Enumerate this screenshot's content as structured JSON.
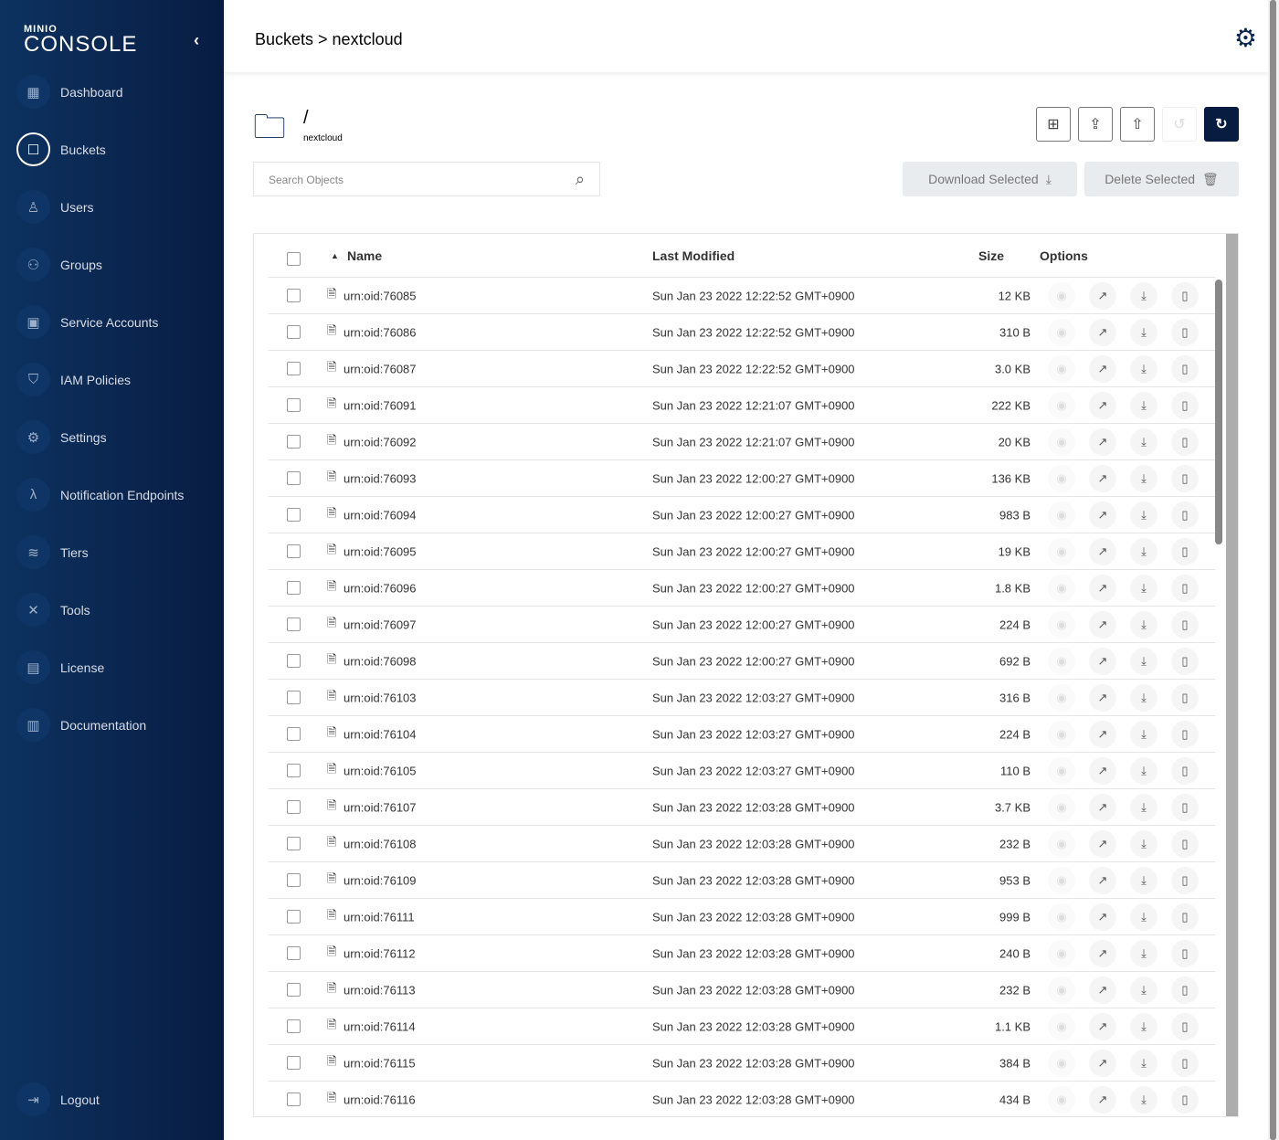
{
  "sidebar": {
    "logo_top": "MINIO",
    "logo_bottom": "CONSOLE",
    "items": [
      {
        "label": "Dashboard",
        "icon": "dashboard-icon",
        "glyph": "▦"
      },
      {
        "label": "Buckets",
        "icon": "bucket-icon",
        "glyph": "☐",
        "active": true
      },
      {
        "label": "Users",
        "icon": "user-icon",
        "glyph": "♙"
      },
      {
        "label": "Groups",
        "icon": "groups-icon",
        "glyph": "⚇"
      },
      {
        "label": "Service Accounts",
        "icon": "service-accounts-icon",
        "glyph": "▣"
      },
      {
        "label": "IAM Policies",
        "icon": "shield-icon",
        "glyph": "⛉"
      },
      {
        "label": "Settings",
        "icon": "gear-icon",
        "glyph": "⚙"
      },
      {
        "label": "Notification Endpoints",
        "icon": "lambda-icon",
        "glyph": "λ"
      },
      {
        "label": "Tiers",
        "icon": "layers-icon",
        "glyph": "≋"
      },
      {
        "label": "Tools",
        "icon": "tools-icon",
        "glyph": "✕"
      },
      {
        "label": "License",
        "icon": "license-icon",
        "glyph": "▤"
      },
      {
        "label": "Documentation",
        "icon": "documentation-icon",
        "glyph": "▥"
      }
    ],
    "logout": "Logout"
  },
  "header": {
    "breadcrumb": "Buckets > nextcloud"
  },
  "browser": {
    "path": "/",
    "bucket": "nextcloud",
    "search_placeholder": "Search Objects",
    "download_selected": "Download Selected",
    "delete_selected": "Delete Selected"
  },
  "table": {
    "columns": {
      "name": "Name",
      "modified": "Last Modified",
      "size": "Size",
      "options": "Options"
    },
    "rows": [
      [
        "urn:oid:76085",
        "Sun Jan 23 2022 12:22:52 GMT+0900",
        "12 KB"
      ],
      [
        "urn:oid:76086",
        "Sun Jan 23 2022 12:22:52 GMT+0900",
        "310 B"
      ],
      [
        "urn:oid:76087",
        "Sun Jan 23 2022 12:22:52 GMT+0900",
        "3.0 KB"
      ],
      [
        "urn:oid:76091",
        "Sun Jan 23 2022 12:21:07 GMT+0900",
        "222 KB"
      ],
      [
        "urn:oid:76092",
        "Sun Jan 23 2022 12:21:07 GMT+0900",
        "20 KB"
      ],
      [
        "urn:oid:76093",
        "Sun Jan 23 2022 12:00:27 GMT+0900",
        "136 KB"
      ],
      [
        "urn:oid:76094",
        "Sun Jan 23 2022 12:00:27 GMT+0900",
        "983 B"
      ],
      [
        "urn:oid:76095",
        "Sun Jan 23 2022 12:00:27 GMT+0900",
        "19 KB"
      ],
      [
        "urn:oid:76096",
        "Sun Jan 23 2022 12:00:27 GMT+0900",
        "1.8 KB"
      ],
      [
        "urn:oid:76097",
        "Sun Jan 23 2022 12:00:27 GMT+0900",
        "224 B"
      ],
      [
        "urn:oid:76098",
        "Sun Jan 23 2022 12:00:27 GMT+0900",
        "692 B"
      ],
      [
        "urn:oid:76103",
        "Sun Jan 23 2022 12:03:27 GMT+0900",
        "316 B"
      ],
      [
        "urn:oid:76104",
        "Sun Jan 23 2022 12:03:27 GMT+0900",
        "224 B"
      ],
      [
        "urn:oid:76105",
        "Sun Jan 23 2022 12:03:27 GMT+0900",
        "110 B"
      ],
      [
        "urn:oid:76107",
        "Sun Jan 23 2022 12:03:28 GMT+0900",
        "3.7 KB"
      ],
      [
        "urn:oid:76108",
        "Sun Jan 23 2022 12:03:28 GMT+0900",
        "232 B"
      ],
      [
        "urn:oid:76109",
        "Sun Jan 23 2022 12:03:28 GMT+0900",
        "953 B"
      ],
      [
        "urn:oid:76111",
        "Sun Jan 23 2022 12:03:28 GMT+0900",
        "999 B"
      ],
      [
        "urn:oid:76112",
        "Sun Jan 23 2022 12:03:28 GMT+0900",
        "240 B"
      ],
      [
        "urn:oid:76113",
        "Sun Jan 23 2022 12:03:28 GMT+0900",
        "232 B"
      ],
      [
        "urn:oid:76114",
        "Sun Jan 23 2022 12:03:28 GMT+0900",
        "1.1 KB"
      ],
      [
        "urn:oid:76115",
        "Sun Jan 23 2022 12:03:28 GMT+0900",
        "384 B"
      ],
      [
        "urn:oid:76116",
        "Sun Jan 23 2022 12:03:28 GMT+0900",
        "434 B"
      ]
    ]
  }
}
